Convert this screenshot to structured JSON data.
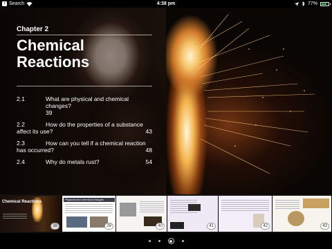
{
  "status_bar": {
    "back_label": "Search",
    "time": "4:38 pm",
    "battery": "77%",
    "battery_level": 0.77
  },
  "chapter": {
    "label": "Chapter 2",
    "title": "Chemical Reactions"
  },
  "toc": [
    {
      "num": "2.1",
      "text": "What are physical and chemical changes?",
      "page": "39"
    },
    {
      "num": "2.2",
      "text": "How do the properties of a substance affect its use?",
      "page": "43"
    },
    {
      "num": "2.3",
      "text": "How can you tell if a chemical reaction has occurred?",
      "page": "48"
    },
    {
      "num": "2.4",
      "text": "Why do metals rust?",
      "page": "54"
    }
  ],
  "thumbnails": [
    {
      "page": "38",
      "title": "Chemical Reactions"
    },
    {
      "page": "39",
      "title": "Physical and chemical changes"
    },
    {
      "page": "40"
    },
    {
      "page": "41"
    },
    {
      "page": "42"
    },
    {
      "page": "43"
    }
  ],
  "icons": {
    "wifi": "wifi-icon",
    "location": "location-arrow-icon",
    "bluetooth": "bluetooth-icon",
    "battery": "battery-icon"
  },
  "colors": {
    "battery_fill": "#4cd964"
  }
}
